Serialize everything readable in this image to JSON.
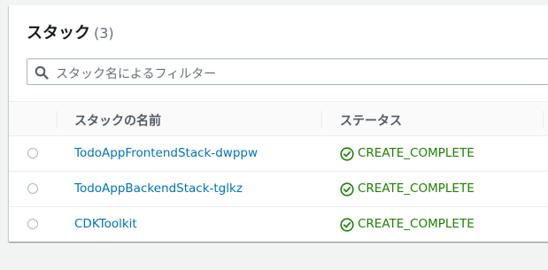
{
  "header": {
    "title": "スタック",
    "count": "(3)"
  },
  "search": {
    "placeholder": "スタック名によるフィルター",
    "icon": "search-icon"
  },
  "table": {
    "columns": [
      "スタックの名前",
      "ステータス"
    ],
    "rows": [
      {
        "name": "TodoAppFrontendStack-dwppw",
        "status": "CREATE_COMPLETE",
        "selected": false
      },
      {
        "name": "TodoAppBackendStack-tglkz",
        "status": "CREATE_COMPLETE",
        "selected": false
      },
      {
        "name": "CDKToolkit",
        "status": "CREATE_COMPLETE",
        "selected": false
      }
    ]
  },
  "colors": {
    "link": "#0073bb",
    "success": "#1d8102",
    "text": "#16191f",
    "muted": "#687078"
  }
}
